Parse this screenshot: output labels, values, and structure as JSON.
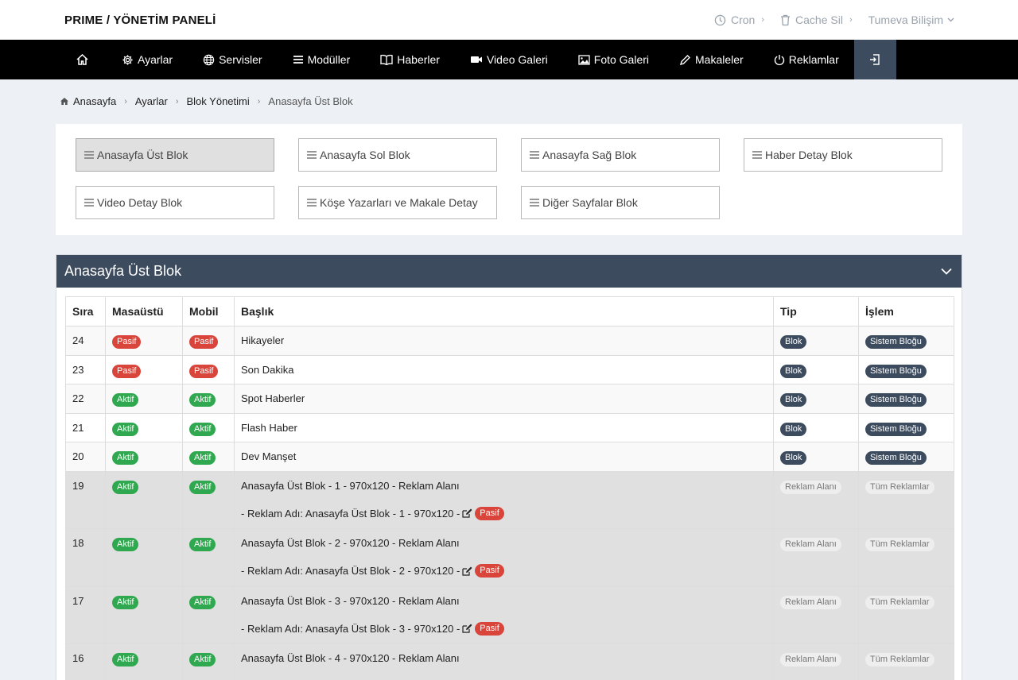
{
  "brand": "PRIME / YÖNETİM PANELİ",
  "top_links": {
    "cron": "Cron",
    "cache": "Cache Sil",
    "user": "Tumeva Bilişim"
  },
  "nav": {
    "items": [
      "Ayarlar",
      "Servisler",
      "Modüller",
      "Haberler",
      "Video Galeri",
      "Foto Galeri",
      "Makaleler",
      "Reklamlar"
    ],
    "icons": [
      "gear-icon",
      "globe-icon",
      "list-icon",
      "book-icon",
      "video-icon",
      "image-icon",
      "pencil-icon",
      "power-icon"
    ]
  },
  "breadcrumb": [
    "Anasayfa",
    "Ayarlar",
    "Blok Yönetimi",
    "Anasayfa Üst Blok"
  ],
  "block_buttons": [
    "Anasayfa Üst Blok",
    "Anasayfa Sol Blok",
    "Anasayfa Sağ Blok",
    "Haber Detay Blok",
    "Video Detay Blok",
    "Köşe Yazarları ve Makale Detay",
    "Diğer Sayfalar Blok"
  ],
  "panel": {
    "title": "Anasayfa Üst Blok",
    "columns": [
      "Sıra",
      "Masaüstü",
      "Mobil",
      "Başlık",
      "Tip",
      "İşlem"
    ],
    "rows": [
      {
        "sira": "24",
        "desktop": "Pasif",
        "mobile": "Pasif",
        "title": "Hikayeler",
        "tip": "Blok",
        "islem": "Sistem Bloğu"
      },
      {
        "sira": "23",
        "desktop": "Pasif",
        "mobile": "Pasif",
        "title": "Son Dakika",
        "tip": "Blok",
        "islem": "Sistem Bloğu"
      },
      {
        "sira": "22",
        "desktop": "Aktif",
        "mobile": "Aktif",
        "title": "Spot Haberler",
        "tip": "Blok",
        "islem": "Sistem Bloğu"
      },
      {
        "sira": "21",
        "desktop": "Aktif",
        "mobile": "Aktif",
        "title": "Flash Haber",
        "tip": "Blok",
        "islem": "Sistem Bloğu"
      },
      {
        "sira": "20",
        "desktop": "Aktif",
        "mobile": "Aktif",
        "title": "Dev Manşet",
        "tip": "Blok",
        "islem": "Sistem Bloğu"
      }
    ],
    "ad_rows": [
      {
        "sira": "19",
        "desktop": "Aktif",
        "mobile": "Aktif",
        "title": "Anasayfa Üst Blok - 1 - 970x120 - Reklam Alanı",
        "ad_name": "- Reklam Adı: Anasayfa Üst Blok - 1 - 970x120 -",
        "ad_status": "Pasif",
        "tip": "Reklam Alanı",
        "islem": "Tüm Reklamlar"
      },
      {
        "sira": "18",
        "desktop": "Aktif",
        "mobile": "Aktif",
        "title": "Anasayfa Üst Blok - 2 - 970x120 - Reklam Alanı",
        "ad_name": "- Reklam Adı: Anasayfa Üst Blok - 2 - 970x120 -",
        "ad_status": "Pasif",
        "tip": "Reklam Alanı",
        "islem": "Tüm Reklamlar"
      },
      {
        "sira": "17",
        "desktop": "Aktif",
        "mobile": "Aktif",
        "title": "Anasayfa Üst Blok - 3 - 970x120 - Reklam Alanı",
        "ad_name": "- Reklam Adı: Anasayfa Üst Blok - 3 - 970x120 -",
        "ad_status": "Pasif",
        "tip": "Reklam Alanı",
        "islem": "Tüm Reklamlar"
      },
      {
        "sira": "16",
        "desktop": "Aktif",
        "mobile": "Aktif",
        "title": "Anasayfa Üst Blok - 4 - 970x120 - Reklam Alanı",
        "tip": "Reklam Alanı",
        "islem": "Tüm Reklamlar"
      }
    ]
  },
  "colors": {
    "navbar": "#000000",
    "panel_header": "#3d4b5e",
    "badge_red": "#d9453b",
    "badge_green": "#2fa84f"
  }
}
